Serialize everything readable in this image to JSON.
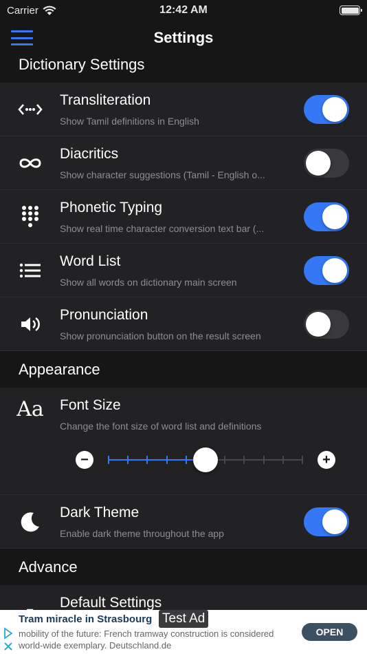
{
  "status": {
    "carrier": "Carrier",
    "time": "12:42 AM"
  },
  "nav": {
    "title": "Settings"
  },
  "sections": {
    "dictionary": "Dictionary Settings",
    "appearance": "Appearance",
    "advance": "Advance"
  },
  "rows": [
    {
      "title": "Transliteration",
      "subtitle": "Show Tamil definitions in English",
      "icon": "transliteration-icon",
      "on": true
    },
    {
      "title": "Diacritics",
      "subtitle": "Show character suggestions (Tamil - English o...",
      "icon": "infinity-icon",
      "on": false
    },
    {
      "title": "Phonetic Typing",
      "subtitle": "Show real time character conversion text bar (...",
      "icon": "keypad-icon",
      "on": true
    },
    {
      "title": "Word List",
      "subtitle": "Show all words on dictionary main screen",
      "icon": "list-icon",
      "on": true
    },
    {
      "title": "Pronunciation",
      "subtitle": "Show pronunciation button on the result screen",
      "icon": "speaker-icon",
      "on": false
    }
  ],
  "font_size": {
    "title": "Font Size",
    "subtitle": "Change the font size of word list and definitions",
    "icon": "font-size-icon",
    "minus": "−",
    "plus": "+",
    "steps": 11,
    "value_step": 5
  },
  "dark_theme": {
    "title": "Dark Theme",
    "subtitle": "Enable dark theme throughout the app",
    "icon": "moon-icon",
    "on": true
  },
  "default_settings": {
    "title": "Default Settings",
    "icon": "arrow-icon"
  },
  "ad": {
    "label": "Test Ad",
    "title": "Tram miracle in Strasbourg",
    "text": "mobility of the future: French tramway construction is considered world-wide exemplary. Deutschland.de",
    "button": "OPEN"
  },
  "colors": {
    "accent": "#3478f6",
    "background": "#161617",
    "row": "#222224"
  }
}
